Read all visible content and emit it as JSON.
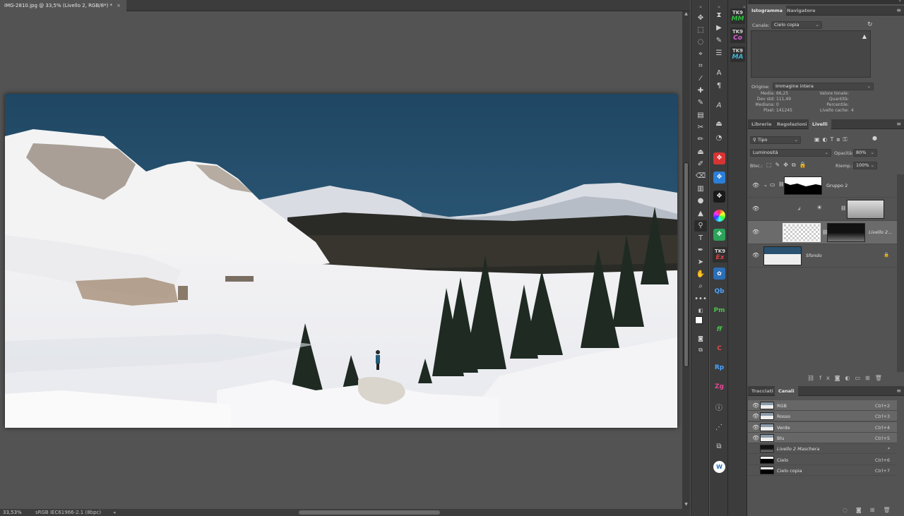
{
  "document": {
    "tab_title": "IMG-2810.jpg @ 33,5% (Livello 2, RGB/8*) *",
    "zoom": "33,53%",
    "color_profile": "sRGB IEC61966-2.1 (8bpc)"
  },
  "panels": {
    "histogram": {
      "tabs": [
        "Istogramma",
        "Navigatore"
      ],
      "channel_label": "Canale:",
      "channel_value": "Cielo copia",
      "origin_label": "Origine:",
      "origin_value": "Immagine intera",
      "stats_left": [
        {
          "label": "Media:",
          "value": "66,25"
        },
        {
          "label": "Dev std:",
          "value": "111,49"
        },
        {
          "label": "Mediana:",
          "value": "0"
        },
        {
          "label": "Pixel:",
          "value": "141245"
        }
      ],
      "stats_right": [
        {
          "label": "Valore tonale:",
          "value": ""
        },
        {
          "label": "Quantità:",
          "value": ""
        },
        {
          "label": "Percentile:",
          "value": ""
        },
        {
          "label": "Livello cache:",
          "value": "4"
        }
      ]
    },
    "layers": {
      "tabs": [
        "Librerie",
        "Regolazioni",
        "Livelli"
      ],
      "filter_value": "Tipo",
      "blend_mode": "Luminosità",
      "opacity_label": "Opacità:",
      "opacity_value": "80%",
      "lock_label": "Bloc.:",
      "fill_label": "Riemp.:",
      "fill_value": "100%",
      "items": [
        {
          "name": "Gruppo 2"
        },
        {
          "name": ""
        },
        {
          "name": "Livello 2..."
        },
        {
          "name": "Sfondo"
        }
      ]
    },
    "channels": {
      "tabs": [
        "Tracciati",
        "Canali"
      ],
      "items": [
        {
          "name": "RGB",
          "shortcut": "Ctrl+2"
        },
        {
          "name": "Rosso",
          "shortcut": "Ctrl+3"
        },
        {
          "name": "Verde",
          "shortcut": "Ctrl+4"
        },
        {
          "name": "Blu",
          "shortcut": "Ctrl+5"
        },
        {
          "name": "Livello 2 Maschera",
          "shortcut": "*"
        },
        {
          "name": "Cielo",
          "shortcut": "Ctrl+6"
        },
        {
          "name": "Cielo copia",
          "shortcut": "Ctrl+7"
        }
      ]
    }
  },
  "plugins": {
    "tk_top": [
      {
        "a": "TK9",
        "b": "MM",
        "color": "#2fbf3f"
      },
      {
        "a": "TK9",
        "b": "Co",
        "color": "#d65fd6"
      },
      {
        "a": "TK9",
        "b": "MA",
        "color": "#3fb6d8"
      }
    ],
    "tk_ex": {
      "a": "TK9",
      "b": "Ex",
      "color": "#e04040"
    },
    "letters": [
      {
        "t": "Qb",
        "color": "#4aa3ff"
      },
      {
        "t": "Pm",
        "color": "#4ac24a"
      },
      {
        "t": "ff",
        "color": "#4ac24a"
      },
      {
        "t": "C",
        "color": "#e04848"
      },
      {
        "t": "Rp",
        "color": "#4aa3ff"
      },
      {
        "t": "Zg",
        "color": "#e04890"
      }
    ]
  }
}
